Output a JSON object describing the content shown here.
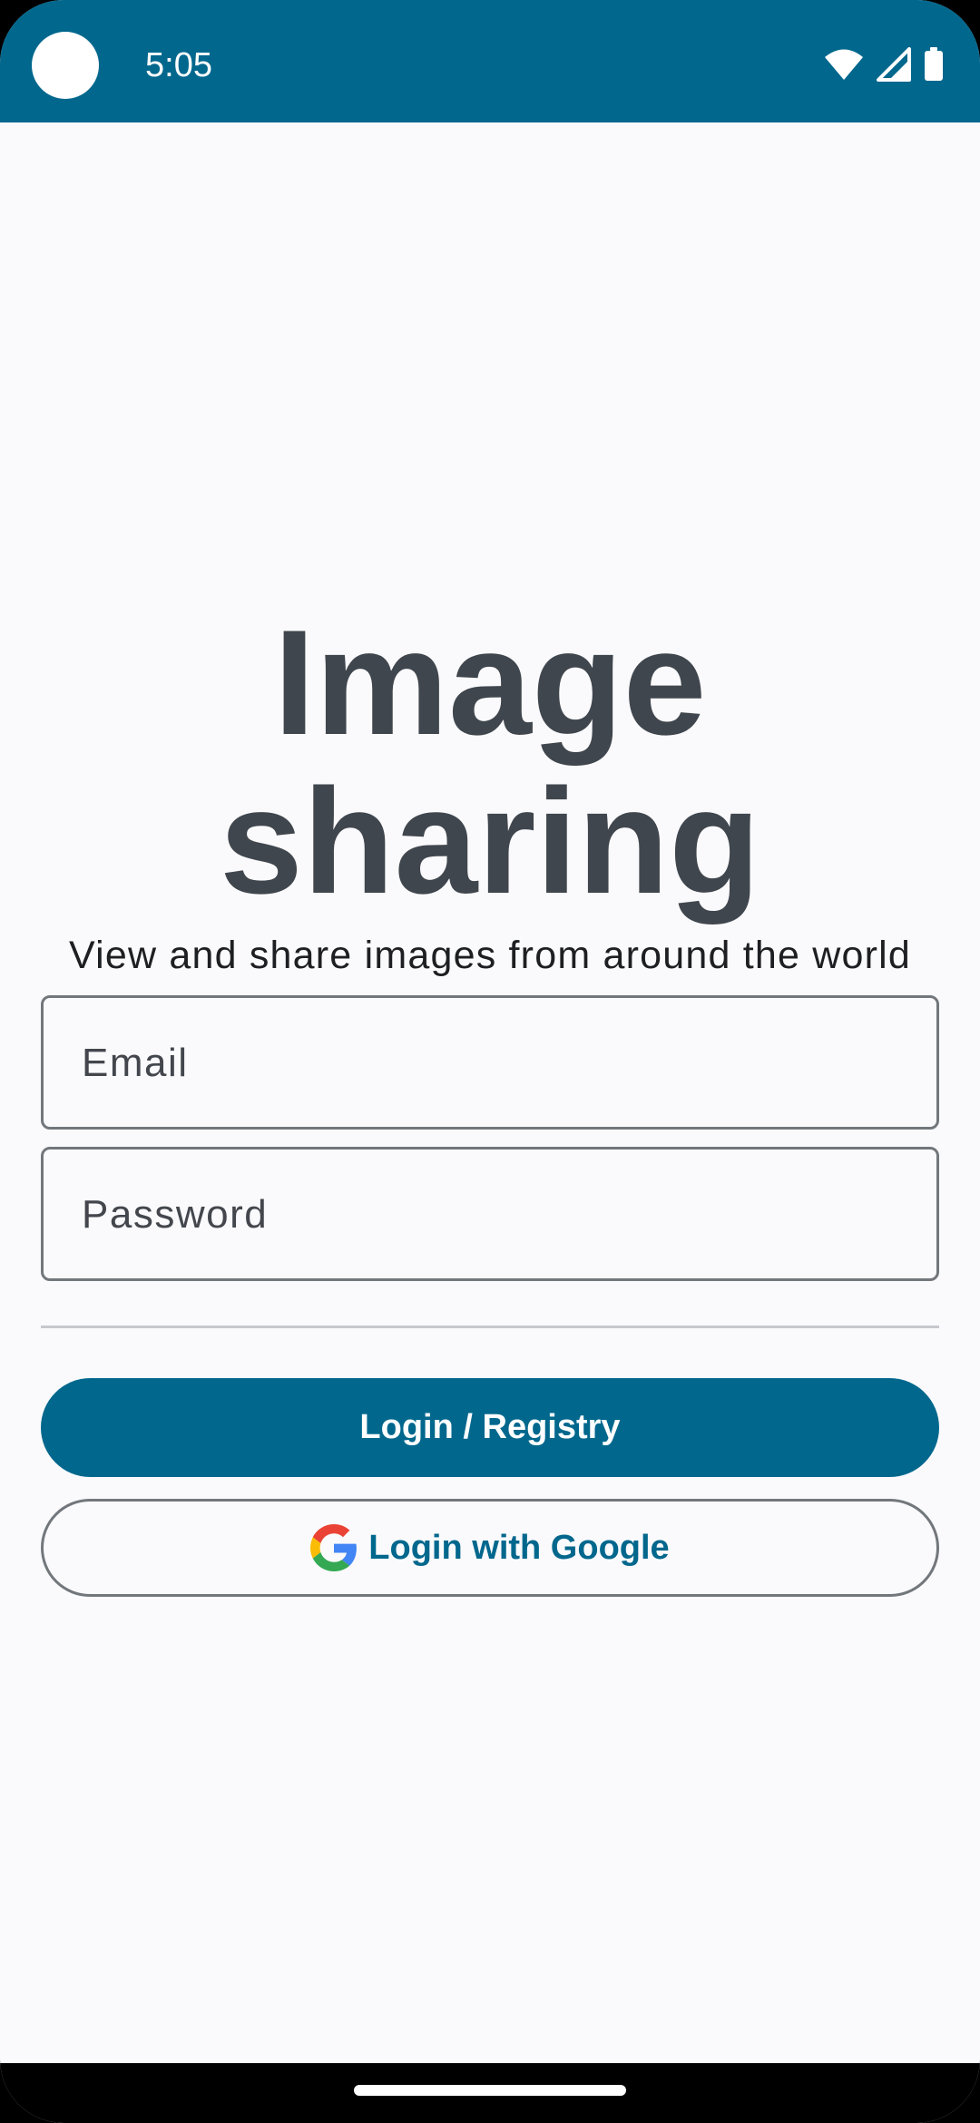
{
  "status_bar": {
    "time": "5:05",
    "icons": [
      "wifi-icon",
      "cellular-signal-icon",
      "battery-icon"
    ],
    "background_color": "#01678D"
  },
  "app": {
    "title": "Image sharing",
    "subtitle": "View and share images from around the world"
  },
  "form": {
    "email_placeholder": "Email",
    "email_value": "",
    "password_placeholder": "Password",
    "password_value": ""
  },
  "actions": {
    "login_label": "Login / Registry",
    "google_label": "Login with Google",
    "google_icon": "google-logo-icon"
  },
  "colors": {
    "primary": "#01678D",
    "title_text": "#40464D",
    "outline": "#72777C",
    "background": "#FAFAFC"
  }
}
